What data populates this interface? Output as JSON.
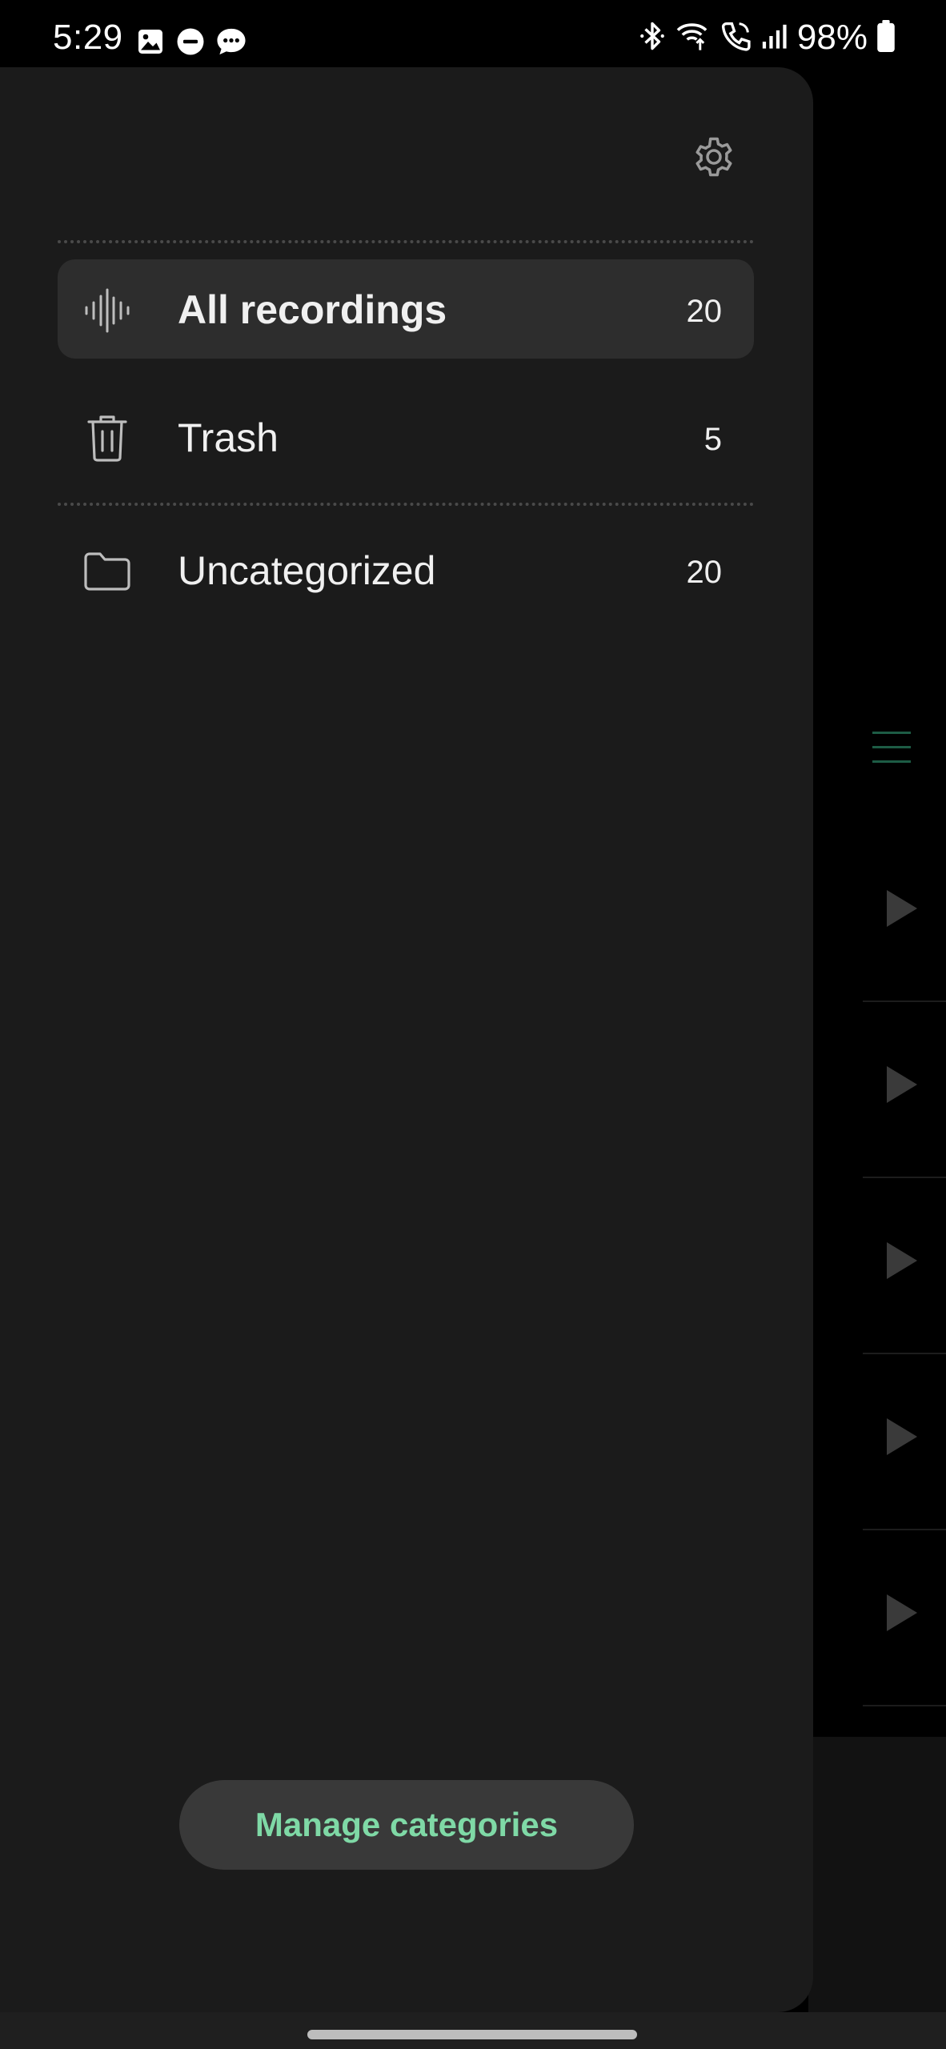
{
  "status_bar": {
    "time": "5:29",
    "battery": "98%",
    "left_icons": [
      "gallery-icon",
      "do-not-disturb-icon",
      "messages-icon"
    ],
    "right_icons": [
      "bluetooth-icon",
      "wifi-calling-icon",
      "call-icon",
      "signal-icon",
      "battery-icon"
    ]
  },
  "drawer": {
    "settings_icon": "gear-icon",
    "items": [
      {
        "icon": "waveform-icon",
        "label": "All recordings",
        "count": "20",
        "active": true
      },
      {
        "icon": "trash-icon",
        "label": "Trash",
        "count": "5",
        "active": false
      },
      {
        "icon": "folder-icon",
        "label": "Uncategorized",
        "count": "20",
        "active": false
      }
    ],
    "manage_button_label": "Manage categories"
  },
  "colors": {
    "accent": "#7fd9a6",
    "drawer_bg": "#1b1b1b",
    "active_item_bg": "#2d2d2d",
    "button_bg": "#393939"
  }
}
